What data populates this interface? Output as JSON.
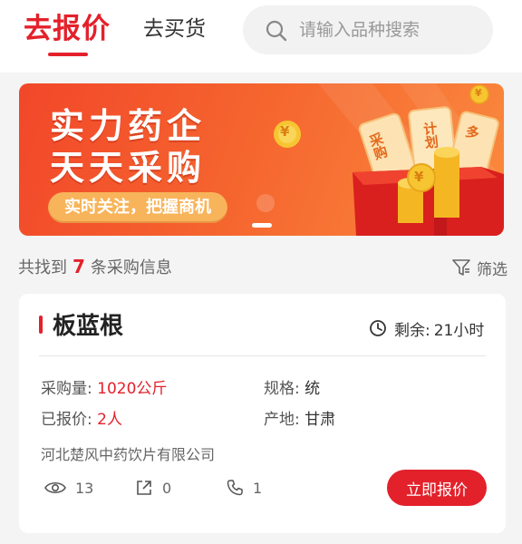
{
  "header": {
    "tab_active": "去报价",
    "tab_inactive": "去买货",
    "search_placeholder": "请输入品种搜索"
  },
  "banner": {
    "line1": "实力药企",
    "line2": "天天采购",
    "pill": "实时关注，把握商机",
    "ticket1": "采购",
    "ticket2": "计划",
    "ticket3": "多",
    "coin_symbol": "¥"
  },
  "results": {
    "prefix": "共找到",
    "count": "7",
    "suffix": "条采购信息",
    "filter_label": "筛选"
  },
  "card": {
    "title": "板蓝根",
    "remaining_label": "剩余:",
    "remaining_value": "21小时",
    "quantity_label": "采购量:",
    "quantity_value": "1020公斤",
    "spec_label": "规格:",
    "spec_value": "统",
    "quoted_label": "已报价:",
    "quoted_value": "2人",
    "origin_label": "产地:",
    "origin_value": "甘肃",
    "company": "河北楚风中药饮片有限公司",
    "views": "13",
    "shares": "0",
    "calls": "1",
    "quote_button": "立即报价"
  },
  "colors": {
    "accent": "#e3212b",
    "banner_start": "#f2472a",
    "banner_end": "#fa8a3e",
    "gift_box": "#d9201e",
    "coin": "#f7c531"
  },
  "icons": [
    "search-icon",
    "filter-icon",
    "clock-icon",
    "eye-icon",
    "share-icon",
    "phone-icon",
    "coin-icon",
    "gift-box-icon"
  ]
}
